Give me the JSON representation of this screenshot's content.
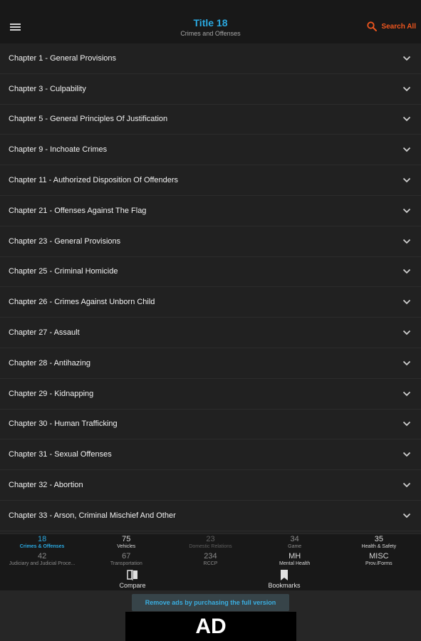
{
  "header": {
    "title": "Title 18",
    "subtitle": "Crimes and Offenses",
    "search_label": "Search All",
    "accent_color": "#2aa8e0",
    "search_color": "#f0561e",
    "menu_icon": "hamburger-menu-icon",
    "search_icon": "search-icon"
  },
  "chapters": [
    {
      "label": "Chapter 1 - General Provisions"
    },
    {
      "label": "Chapter 3 - Culpability"
    },
    {
      "label": "Chapter 5 - General Principles Of Justification"
    },
    {
      "label": "Chapter 9 - Inchoate Crimes"
    },
    {
      "label": "Chapter 11 - Authorized Disposition Of Offenders"
    },
    {
      "label": "Chapter 21 - Offenses Against The Flag"
    },
    {
      "label": "Chapter 23 - General Provisions"
    },
    {
      "label": "Chapter 25 - Criminal Homicide"
    },
    {
      "label": "Chapter 26 - Crimes Against Unborn Child"
    },
    {
      "label": "Chapter 27 - Assault"
    },
    {
      "label": "Chapter 28 - Antihazing"
    },
    {
      "label": "Chapter 29 - Kidnapping"
    },
    {
      "label": "Chapter 30 - Human Trafficking"
    },
    {
      "label": "Chapter 31 - Sexual Offenses"
    },
    {
      "label": "Chapter 32 - Abortion"
    },
    {
      "label": "Chapter 33 - Arson, Criminal Mischief And Other"
    }
  ],
  "nav": {
    "row1": [
      {
        "num": "18",
        "label": "Crimes & Offenses",
        "state": "active"
      },
      {
        "num": "75",
        "label": "Vehicles",
        "state": "normal"
      },
      {
        "num": "23",
        "label": "Domestic Relations",
        "state": "dim"
      },
      {
        "num": "34",
        "label": "Game",
        "state": "mid"
      },
      {
        "num": "35",
        "label": "Health & Safety",
        "state": "normal"
      }
    ],
    "row2": [
      {
        "num": "42",
        "label": "Judiciary and Judicial Proce...",
        "state": "mid"
      },
      {
        "num": "67",
        "label": "Transportation",
        "state": "mid"
      },
      {
        "num": "234",
        "label": "RCCP",
        "state": "mid"
      },
      {
        "num": "MH",
        "label": "Mental Health",
        "state": "normal"
      },
      {
        "num": "MISC",
        "label": "Prov./Forms",
        "state": "normal"
      }
    ],
    "compare_label": "Compare",
    "compare_icon": "compare-icon",
    "bookmarks_label": "Bookmarks",
    "bookmarks_icon": "bookmark-icon"
  },
  "ad": {
    "remove_ads_label": "Remove ads by purchasing the full version",
    "ad_text": "AD"
  }
}
